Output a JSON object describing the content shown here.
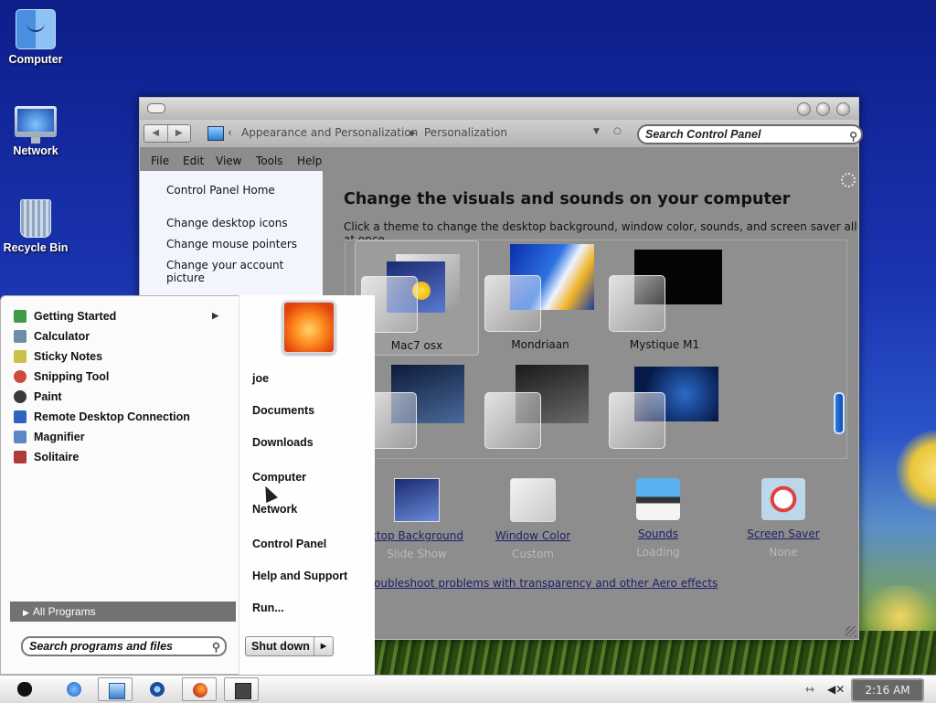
{
  "desktop": {
    "icons": [
      {
        "label": "Computer"
      },
      {
        "label": "Network"
      },
      {
        "label": "Recycle Bin"
      }
    ]
  },
  "window": {
    "breadcrumb": [
      "Appearance and Personalization",
      "Personalization"
    ],
    "search_placeholder": "Search Control Panel",
    "menu": [
      "File",
      "Edit",
      "View",
      "Tools",
      "Help"
    ],
    "nav_links": [
      "Control Panel Home",
      "Change desktop icons",
      "Change mouse pointers",
      "Change your account picture"
    ],
    "heading": "Change the visuals and sounds on your computer",
    "subheading": "Click a theme to change the desktop background, window color, sounds, and screen saver all at once.",
    "themes": [
      {
        "label": "Mac7 osx",
        "selected": true
      },
      {
        "label": "Mondriaan"
      },
      {
        "label": "Mystique M1"
      }
    ],
    "properties": [
      {
        "label": "ktop Background",
        "value": "Slide Show"
      },
      {
        "label": "Window Color",
        "value": "Custom"
      },
      {
        "label": "Sounds",
        "value": "Loading"
      },
      {
        "label": "Screen Saver",
        "value": "None"
      }
    ],
    "aero_link": "oubleshoot problems with transparency and other Aero effects"
  },
  "start_menu": {
    "programs": [
      {
        "label": "Getting Started",
        "has_submenu": true,
        "color": "#3f9a4a"
      },
      {
        "label": "Calculator",
        "color": "#6f8da8"
      },
      {
        "label": "Sticky Notes",
        "color": "#c9c24a"
      },
      {
        "label": "Snipping Tool",
        "color": "#d04a3a"
      },
      {
        "label": "Paint",
        "color": "#3a3a3a"
      },
      {
        "label": "Remote Desktop Connection",
        "color": "#2f63c0"
      },
      {
        "label": "Magnifier",
        "color": "#5d86c4"
      },
      {
        "label": "Solitaire",
        "color": "#b03a3a"
      }
    ],
    "all_programs": "All Programs",
    "search_placeholder": "Search programs and files",
    "places": [
      "joe",
      "Documents",
      "Downloads",
      "Computer",
      "Network",
      "Control Panel",
      "Help and Support",
      "Run..."
    ],
    "shutdown_label": "Shut down"
  },
  "taskbar": {
    "clock": "2:16 AM",
    "buttons": [
      "apple-menu",
      "web-browser",
      "file-explorer",
      "quicktime",
      "firefox",
      "control-panel"
    ]
  },
  "colors": {
    "accent": "#2c7ae0",
    "window_body": "#8d8d8d",
    "link": "#1e1e6a"
  }
}
